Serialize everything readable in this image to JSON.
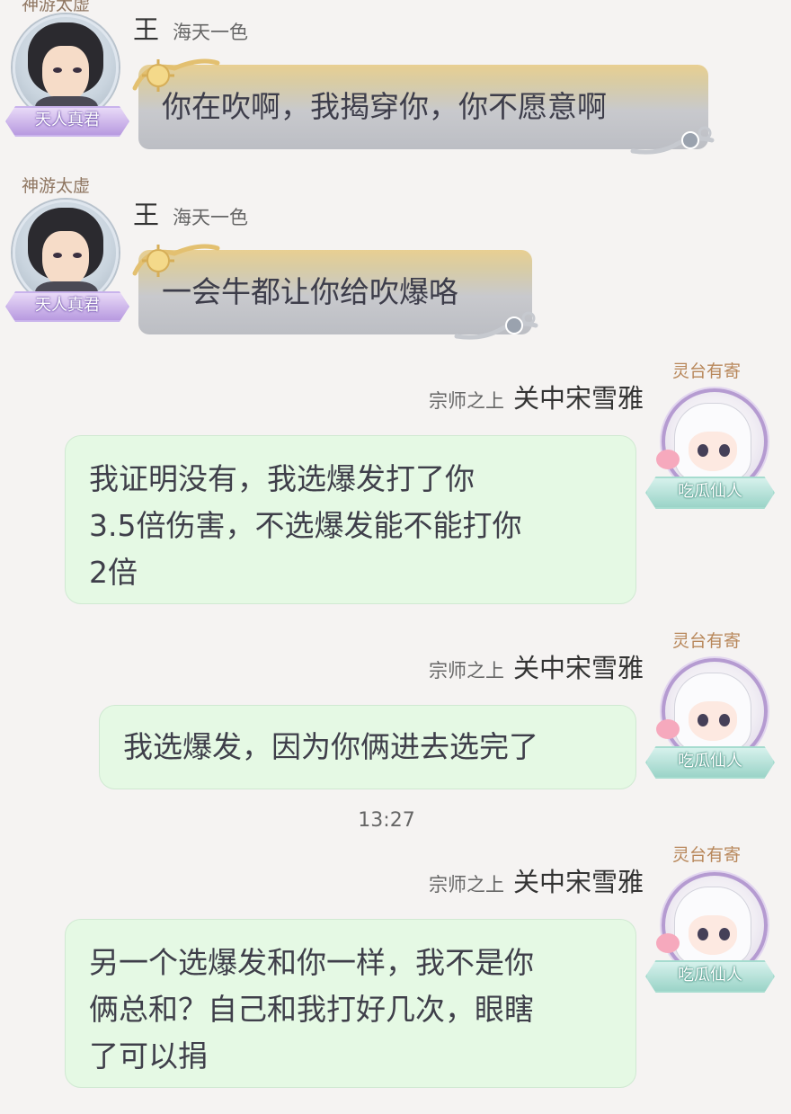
{
  "messages": [
    {
      "side": "left",
      "title": "神游太虚",
      "name": "王",
      "server": "海天一色",
      "badge": "天人真君",
      "text": "你在吹啊，我揭穿你，你不愿意啊"
    },
    {
      "side": "left",
      "title": "神游太虚",
      "name": "王",
      "server": "海天一色",
      "badge": "天人真君",
      "text": "一会牛都让你给吹爆咯"
    },
    {
      "side": "right",
      "title": "灵台有寄",
      "server": "宗师之上",
      "name": "关中宋雪雅",
      "badge": "吃瓜仙人",
      "lines": [
        "我证明没有，我选爆发打了你",
        "3.5倍伤害，不选爆发能不能打你",
        "2倍"
      ]
    },
    {
      "side": "right",
      "title": "灵台有寄",
      "server": "宗师之上",
      "name": "关中宋雪雅",
      "badge": "吃瓜仙人",
      "lines": [
        "我选爆发，因为你俩进去选完了"
      ]
    },
    {
      "side": "right",
      "title": "灵台有寄",
      "server": "宗师之上",
      "name": "关中宋雪雅",
      "badge": "吃瓜仙人",
      "lines": [
        "另一个选爆发和你一样，我不是你",
        "俩总和？自己和我打好几次，眼瞎",
        "了可以捐"
      ]
    }
  ],
  "timestamp": "13:27",
  "colors": {
    "background": "#f5f3f2",
    "self_bubble": "#e5f9e4",
    "other_bubble_top": "#e8cf92",
    "other_bubble_bottom": "#bcbec4",
    "left_title": "#8e7560",
    "right_title": "#b8875a"
  }
}
